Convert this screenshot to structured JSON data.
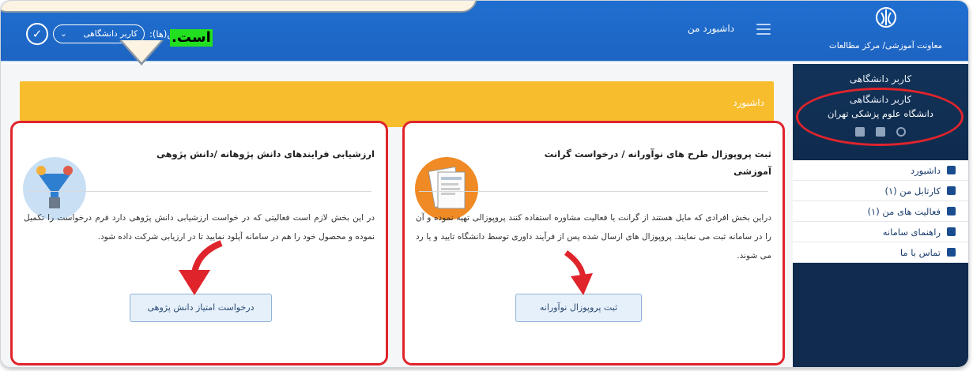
{
  "colors": {
    "header_blue": "#1f6fd0",
    "sidebar_navy": "#102b4d",
    "panel_yellow": "#f7bd2d",
    "highlight_red": "#e0242c",
    "callout_green": "#22e01f"
  },
  "callout": {
    "text": "است."
  },
  "header": {
    "logo_title": "معاونت آموزشی/ مرکز مطالعات",
    "breadcrumb": "داشبورد من",
    "role_label": "نقش(ها):",
    "role_value": "کاربر دانشگاهی",
    "confirm_icon": "check-icon"
  },
  "sidebar": {
    "user_label": "کاربر دانشگاهی",
    "role": "کاربر دانشگاهی",
    "university": "دانشگاه علوم پزشکی تهران",
    "icons": [
      "power-icon",
      "calendar-icon",
      "settings-icon"
    ],
    "items": [
      {
        "label": "داشبورد",
        "icon": "grid-icon"
      },
      {
        "label": "کارتابل من (۱)",
        "icon": "inbox-icon"
      },
      {
        "label": "فعالیت های من (۱)",
        "icon": "activity-icon"
      },
      {
        "label": "راهنمای سامانه",
        "icon": "book-icon"
      },
      {
        "label": "تماس با ما",
        "icon": "phone-icon"
      }
    ]
  },
  "main": {
    "panel_title": "داشبورد",
    "cards": [
      {
        "title": "ثبت پروپوزال طرح های نوآورانه / درخواست گرانت آموزشی",
        "text": "دراین بخش افرادی که مایل هستند از گرانت یا فعالیت مشاوره استفاده کنند پروپوزالی تهیه نموده و آن را در سامانه ثبت می نمایند. پروپوزال های ارسال شده پس از فرآیند داوری توسط دانشگاه تایید و یا رد می شوند.",
        "button": "ثبت پروپوزال نوآورانه"
      },
      {
        "title": "ارزشیابی فرایندهای دانش پژوهانه /دانش پژوهی",
        "text": "در این بخش لازم است فعالیتی که در خواست ارزشیابی دانش پژوهی دارد فرم درخواست را تکمیل نموده و محصول خود را هم در سامانه آپلود نمایید تا در ارزیابی شرکت داده شود.",
        "button": "درخواست امتیاز دانش پژوهی"
      }
    ]
  }
}
